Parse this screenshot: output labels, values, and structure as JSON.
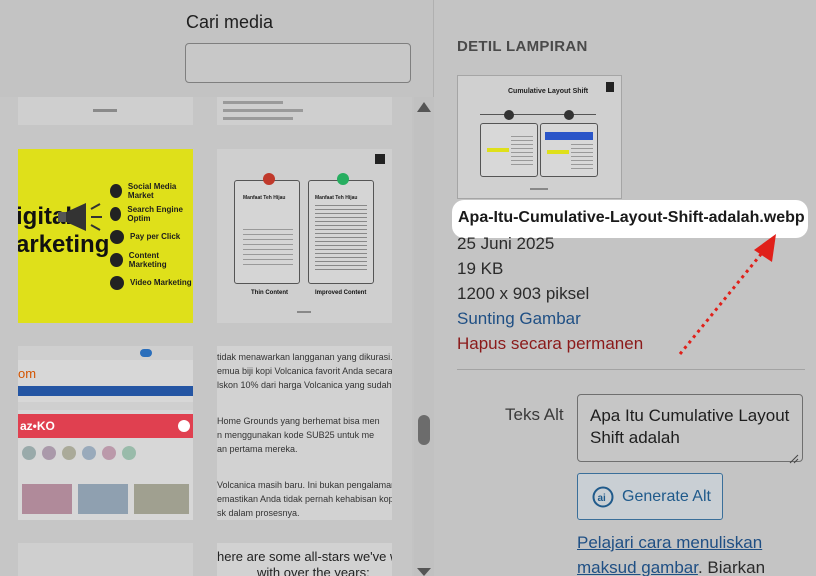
{
  "search": {
    "label": "Cari media",
    "value": "",
    "placeholder": ""
  },
  "grid": {
    "digital_marketing": {
      "left_text_1": "igital",
      "left_text_2": "arketing",
      "items": [
        "Social Media Market",
        "Search Engine Optim",
        "Pay per Click",
        "Content Marketing",
        "Video Marketing"
      ]
    },
    "thin_content": {
      "title_left": "Manfaat Teh Hijau",
      "title_right": "Manfaat Teh Hijau",
      "caption_left": "Thin Content",
      "caption_right": "Improved Content"
    },
    "text_snippets": [
      "tidak menawarkan langganan yang dikurasi. Se",
      "emua biji kopi Volcanica favorit Anda secara be",
      "lskon 10% dari harga Volcanica yang sudah san",
      "Home Grounds yang berhemat bisa men",
      "n menggunakan kode SUB25 untuk me",
      "an pertama mereka.",
      "Volcanica masih baru. Ini bukan pengalaman",
      "emastikan Anda tidak pernah kehabisan kopi",
      "sk dalam prosesnya."
    ],
    "bottom_snippet": "here are some all-stars we've worke",
    "bottom_snippet_2": "with over the years:"
  },
  "detail": {
    "heading": "DETIL LAMPIRAN",
    "preview_title": "Cumulative Layout Shift",
    "filename": "Apa-Itu-Cumulative-Layout-Shift-adalah.webp",
    "date": "25 Juni 2025",
    "size": "19 KB",
    "dimensions": "1200 x 903 piksel",
    "edit_link": "Sunting Gambar",
    "delete_link": "Hapus secara permanen",
    "alt_label": "Teks Alt",
    "alt_value": "Apa Itu Cumulative Layout Shift adalah",
    "generate_button": "Generate Alt",
    "learn_link": "Pelajari cara menuliskan maksud gambar",
    "learn_suffix": ". Biarkan"
  },
  "colors": {
    "arrow": "#e0201a",
    "link": "#1f4f84",
    "danger": "#8b1a1a",
    "yellow": "#dfe01a"
  }
}
